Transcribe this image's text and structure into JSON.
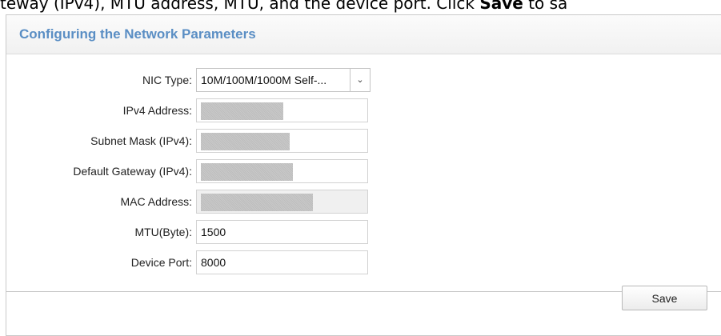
{
  "doc_text": {
    "before_bold": "teway (IPv4), MTU address, MTU, and the device port. Click ",
    "bold": "Save",
    "after_bold": " to sa"
  },
  "panel": {
    "title": "Configuring the Network Parameters"
  },
  "form": {
    "nic_type": {
      "label": "NIC Type:",
      "value": "10M/100M/1000M Self-..."
    },
    "ipv4_address": {
      "label": "IPv4 Address:"
    },
    "subnet_mask": {
      "label": "Subnet Mask (IPv4):"
    },
    "default_gateway": {
      "label": "Default Gateway (IPv4):"
    },
    "mac_address": {
      "label": "MAC Address:"
    },
    "mtu": {
      "label": "MTU(Byte):",
      "value": "1500"
    },
    "device_port": {
      "label": "Device Port:",
      "value": "8000"
    }
  },
  "footer": {
    "save_label": "Save"
  },
  "icons": {
    "dropdown": "chevron-down-icon"
  },
  "colors": {
    "title": "#5a8ec4",
    "mask": "#bdbdbd"
  }
}
